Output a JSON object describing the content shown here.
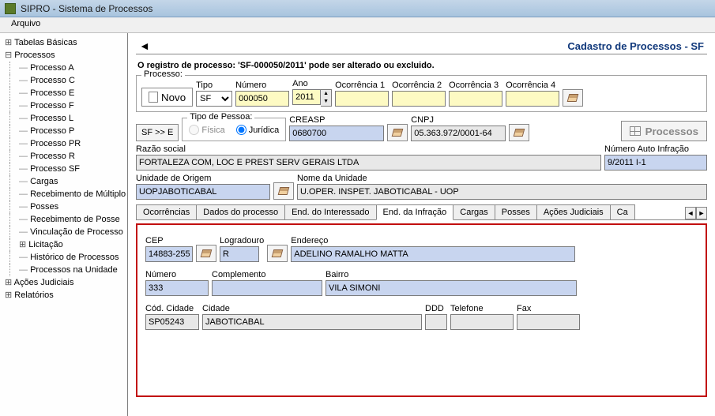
{
  "window": {
    "title": "SIPRO - Sistema de Processos"
  },
  "menubar": {
    "arquivo": "Arquivo"
  },
  "sidebar": {
    "items": [
      {
        "label": "Tabelas Básicas",
        "type": "level1 collapsed"
      },
      {
        "label": "Processos",
        "type": "level1"
      },
      {
        "label": "Processo A",
        "type": "level2"
      },
      {
        "label": "Processo C",
        "type": "level2"
      },
      {
        "label": "Processo E",
        "type": "level2"
      },
      {
        "label": "Processo F",
        "type": "level2"
      },
      {
        "label": "Processo L",
        "type": "level2"
      },
      {
        "label": "Processo P",
        "type": "level2"
      },
      {
        "label": "Processo PR",
        "type": "level2"
      },
      {
        "label": "Processo R",
        "type": "level2"
      },
      {
        "label": "Processo SF",
        "type": "level2"
      },
      {
        "label": "Cargas",
        "type": "level2"
      },
      {
        "label": "Recebimento de Múltiplo",
        "type": "level2"
      },
      {
        "label": "Posses",
        "type": "level2"
      },
      {
        "label": "Recebimento de Posse",
        "type": "level2"
      },
      {
        "label": "Vinculação de Processo",
        "type": "level2"
      },
      {
        "label": "Licitação",
        "type": "level2plus"
      },
      {
        "label": "Histórico de Processos",
        "type": "level2"
      },
      {
        "label": "Processos na Unidade",
        "type": "level2"
      },
      {
        "label": "Ações Judiciais",
        "type": "level1 collapsed"
      },
      {
        "label": "Relatórios",
        "type": "level1 collapsed"
      }
    ]
  },
  "header": {
    "title": "Cadastro de Processos  -   SF"
  },
  "status": "O registro de processo: 'SF-000050/2011' pode ser alterado ou excluido.",
  "processo": {
    "legend": "Processo:",
    "novo": "Novo",
    "tipo_label": "Tipo",
    "tipo_value": "SF",
    "numero_label": "Número",
    "numero_value": "000050",
    "ano_label": "Ano",
    "ano_value": "2011",
    "oc1_label": "Ocorrência 1",
    "oc2_label": "Ocorrência 2",
    "oc3_label": "Ocorrência 3",
    "oc4_label": "Ocorrência 4"
  },
  "row2": {
    "sfe": "SF >> E",
    "tipopessoa_legend": "Tipo de Pessoa:",
    "fisica": "Física",
    "juridica": "Jurídica",
    "creasp_label": "CREASP",
    "creasp_value": "0680700",
    "cnpj_label": "CNPJ",
    "cnpj_value": "05.363.972/0001-64",
    "processos_btn": "Processos"
  },
  "row3": {
    "razao_label": "Razão social",
    "razao_value": "FORTALEZA COM, LOC E PREST SERV GERAIS LTDA",
    "numauto_label": "Número Auto Infração",
    "numauto_value": "9/2011 I-1"
  },
  "row4": {
    "unidade_origem_label": "Unidade de Origem",
    "unidade_origem_value": "UOPJABOTICABAL",
    "nome_unidade_label": "Nome da Unidade",
    "nome_unidade_value": "U.OPER. INSPET. JABOTICABAL - UOP"
  },
  "tabs": {
    "t1": "Ocorrências",
    "t2": "Dados do processo",
    "t3": "End. do Interessado",
    "t4": "End. da Infração",
    "t5": "Cargas",
    "t6": "Posses",
    "t7": "Ações Judiciais",
    "t8": "Ca"
  },
  "infracao": {
    "cep_label": "CEP",
    "cep_value": "14883-255",
    "logradouro_label": "Logradouro",
    "logradouro_value": "R",
    "endereco_label": "Endereço",
    "endereco_value": "ADELINO RAMALHO MATTA",
    "numero_label": "Número",
    "numero_value": "333",
    "complemento_label": "Complemento",
    "complemento_value": "",
    "bairro_label": "Bairro",
    "bairro_value": "VILA SIMONI",
    "codcidade_label": "Cód. Cidade",
    "codcidade_value": "SP05243",
    "cidade_label": "Cidade",
    "cidade_value": "JABOTICABAL",
    "ddd_label": "DDD",
    "ddd_value": "",
    "telefone_label": "Telefone",
    "telefone_value": "",
    "fax_label": "Fax",
    "fax_value": ""
  }
}
